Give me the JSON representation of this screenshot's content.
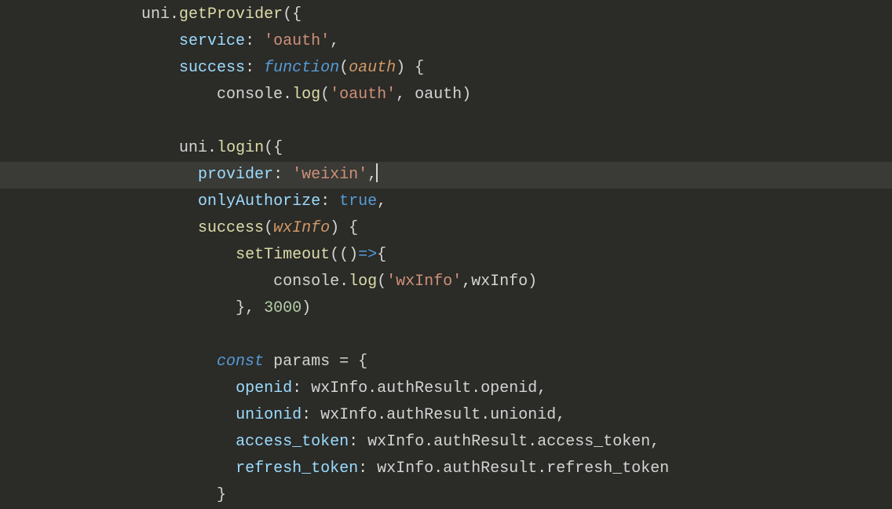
{
  "code": {
    "lines": [
      {
        "indent": "               ",
        "tokens": [
          {
            "t": "text",
            "v": "uni."
          },
          {
            "t": "method",
            "v": "getProvider"
          },
          {
            "t": "text",
            "v": "({"
          }
        ]
      },
      {
        "indent": "                   ",
        "tokens": [
          {
            "t": "prop",
            "v": "service"
          },
          {
            "t": "text",
            "v": ": "
          },
          {
            "t": "string",
            "v": "'oauth'"
          },
          {
            "t": "text",
            "v": ","
          }
        ]
      },
      {
        "indent": "                   ",
        "tokens": [
          {
            "t": "prop",
            "v": "success"
          },
          {
            "t": "text",
            "v": ": "
          },
          {
            "t": "keyword",
            "v": "function"
          },
          {
            "t": "text",
            "v": "("
          },
          {
            "t": "param",
            "v": "oauth"
          },
          {
            "t": "text",
            "v": ") {"
          }
        ]
      },
      {
        "indent": "                       ",
        "tokens": [
          {
            "t": "text",
            "v": "console."
          },
          {
            "t": "method",
            "v": "log"
          },
          {
            "t": "text",
            "v": "("
          },
          {
            "t": "string",
            "v": "'oauth'"
          },
          {
            "t": "text",
            "v": ", oauth)"
          }
        ]
      },
      {
        "indent": "",
        "tokens": []
      },
      {
        "indent": "                   ",
        "tokens": [
          {
            "t": "text",
            "v": "uni."
          },
          {
            "t": "method",
            "v": "login"
          },
          {
            "t": "text",
            "v": "({"
          }
        ]
      },
      {
        "indent": "                     ",
        "highlight": true,
        "cursor": true,
        "tokens": [
          {
            "t": "prop",
            "v": "provider"
          },
          {
            "t": "text",
            "v": ": "
          },
          {
            "t": "string",
            "v": "'weixin'"
          },
          {
            "t": "text",
            "v": ","
          }
        ]
      },
      {
        "indent": "                     ",
        "tokens": [
          {
            "t": "prop",
            "v": "onlyAuthorize"
          },
          {
            "t": "text",
            "v": ": "
          },
          {
            "t": "keyword-nf",
            "v": "true"
          },
          {
            "t": "text",
            "v": ","
          }
        ]
      },
      {
        "indent": "                     ",
        "tokens": [
          {
            "t": "method",
            "v": "success"
          },
          {
            "t": "text",
            "v": "("
          },
          {
            "t": "param",
            "v": "wxInfo"
          },
          {
            "t": "text",
            "v": ") {"
          }
        ]
      },
      {
        "indent": "                         ",
        "tokens": [
          {
            "t": "method",
            "v": "setTimeout"
          },
          {
            "t": "text",
            "v": "(()"
          },
          {
            "t": "keyword-nf",
            "v": "=>"
          },
          {
            "t": "text",
            "v": "{"
          }
        ]
      },
      {
        "indent": "                             ",
        "tokens": [
          {
            "t": "text",
            "v": "console."
          },
          {
            "t": "method",
            "v": "log"
          },
          {
            "t": "text",
            "v": "("
          },
          {
            "t": "string",
            "v": "'wxInfo'"
          },
          {
            "t": "text",
            "v": ",wxInfo)"
          }
        ]
      },
      {
        "indent": "                         ",
        "tokens": [
          {
            "t": "text",
            "v": "}, "
          },
          {
            "t": "number",
            "v": "3000"
          },
          {
            "t": "text",
            "v": ")"
          }
        ]
      },
      {
        "indent": "",
        "tokens": []
      },
      {
        "indent": "                       ",
        "tokens": [
          {
            "t": "keyword",
            "v": "const"
          },
          {
            "t": "text",
            "v": " params "
          },
          {
            "t": "text",
            "v": "= {"
          }
        ]
      },
      {
        "indent": "                         ",
        "tokens": [
          {
            "t": "prop",
            "v": "openid"
          },
          {
            "t": "text",
            "v": ": wxInfo.authResult.openid,"
          }
        ]
      },
      {
        "indent": "                         ",
        "tokens": [
          {
            "t": "prop",
            "v": "unionid"
          },
          {
            "t": "text",
            "v": ": wxInfo.authResult.unionid,"
          }
        ]
      },
      {
        "indent": "                         ",
        "tokens": [
          {
            "t": "prop",
            "v": "access_token"
          },
          {
            "t": "text",
            "v": ": wxInfo.authResult.access_token,"
          }
        ]
      },
      {
        "indent": "                         ",
        "tokens": [
          {
            "t": "prop",
            "v": "refresh_token"
          },
          {
            "t": "text",
            "v": ": wxInfo.authResult.refresh_token"
          }
        ]
      },
      {
        "indent": "                       ",
        "tokens": [
          {
            "t": "text",
            "v": "}"
          }
        ]
      }
    ]
  },
  "colors": {
    "background": "#2b2b28",
    "highlight": "#3a3a36",
    "text": "#d4d4d4",
    "method": "#dcdcaa",
    "prop": "#9cdcfe",
    "string": "#ce9178",
    "keyword": "#569cd6",
    "param": "#d19a66",
    "number": "#b5cea8"
  }
}
